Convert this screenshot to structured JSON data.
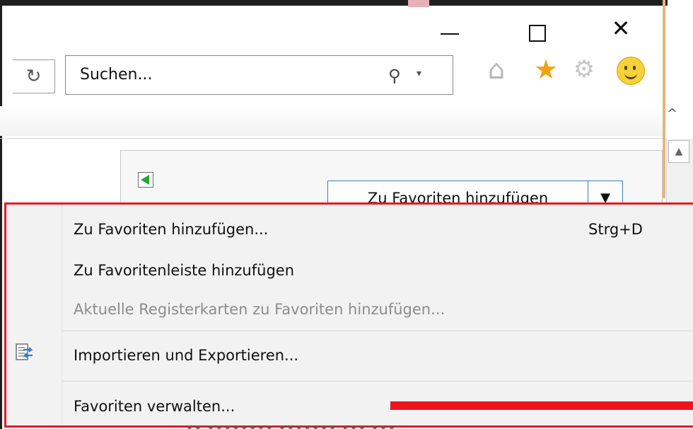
{
  "window": {
    "controls": {
      "minimize_icon": "minimize-icon",
      "maximize_icon": "maximize-icon",
      "close_glyph": "✕"
    }
  },
  "toolbar": {
    "refresh_glyph": "↻",
    "search": {
      "placeholder": "Suchen...",
      "icon": "search-icon",
      "dropdown_glyph": "▾"
    },
    "icons": {
      "home": "⌂",
      "favorites": "★",
      "settings": "⚙",
      "feedback": "smiley-icon"
    },
    "colors": {
      "favorites_star": "#f2a20f"
    }
  },
  "favorites_panel": {
    "back_icon": "back-arrow-icon",
    "add_button_label": "Zu Favoriten hinzufügen",
    "add_button_arrow": "▼"
  },
  "menu": {
    "items": [
      {
        "label": "Zu Favoriten hinzufügen...",
        "shortcut": "Strg+D",
        "enabled": true
      },
      {
        "label": "Zu Favoritenleiste hinzufügen",
        "enabled": true
      },
      {
        "label": "Aktuelle Registerkarten zu Favoriten hinzufügen...",
        "enabled": false
      },
      {
        "label": "Importieren und Exportieren...",
        "icon": "import-export-icon",
        "enabled": true
      },
      {
        "label": "Favoriten verwalten...",
        "enabled": true
      }
    ],
    "highlight_color": "#e21b24"
  },
  "scrollbar": {
    "up_arrow": "▲",
    "caret": "^"
  },
  "partially_visible_text": "xx xxxxxxxx xxxxxxx xxx xxx"
}
